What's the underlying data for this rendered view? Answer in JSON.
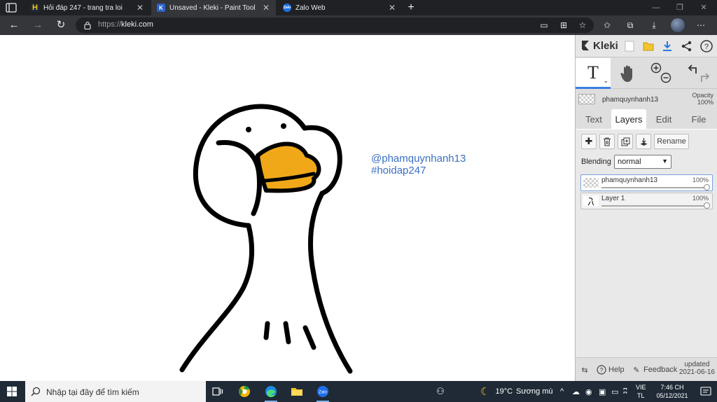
{
  "browser": {
    "tabs": [
      {
        "title": "Hỏi đáp 247 - trang tra loi",
        "favicon": "H",
        "active": false
      },
      {
        "title": "Unsaved - Kleki - Paint Tool",
        "favicon": "K",
        "active": true
      },
      {
        "title": "Zalo Web",
        "favicon": "Zalo",
        "active": false
      }
    ],
    "url_scheme": "https://",
    "url_host": "kleki.com"
  },
  "canvas": {
    "watermark_line1": "@phamquynhanh13",
    "watermark_line2": "#hoidap247",
    "stroke_color": "#000000",
    "beak_color": "#F0A818",
    "watermark_color": "#3A6FC4"
  },
  "kleki": {
    "logo": "Kleki",
    "tool_selected": "T",
    "current_layer": "phamquynhanh13",
    "opacity_label": "Opacity",
    "opacity_value": "100%",
    "tabs": [
      "Text",
      "Layers",
      "Edit",
      "File"
    ],
    "active_tab": "Layers",
    "rename_label": "Rename",
    "blending_label": "Blending",
    "blending_value": "normal",
    "layers": [
      {
        "name": "phamquynhanh13",
        "opacity": "100%",
        "selected": true
      },
      {
        "name": "Layer 1",
        "opacity": "100%",
        "selected": false
      }
    ],
    "footer": {
      "help": "Help",
      "feedback": "Feedback",
      "updated_label": "updated",
      "updated_date": "2021-06-16"
    },
    "accent_color": "#3C7EE0"
  },
  "taskbar": {
    "search_placeholder": "Nhập tại đây để tìm kiếm",
    "weather_temp": "19°C",
    "weather_text": "Sương mù",
    "lang_line1": "VIE",
    "lang_line2": "TL",
    "time": "7:46 CH",
    "date": "05/12/2021"
  }
}
